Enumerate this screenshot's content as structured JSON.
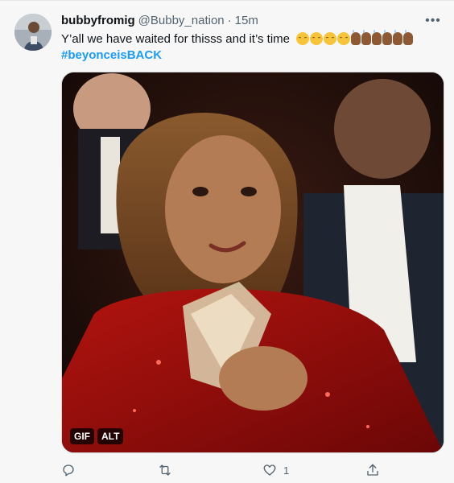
{
  "user": {
    "name": "bubbyfromig",
    "handle": "@Bubby_nation",
    "separator": "·",
    "time": "15m"
  },
  "tweet": {
    "text": "Y’all we have waited for thisss and it’s time",
    "hashtag": "#beyonceisBACK",
    "emoji": [
      "relieved-face",
      "relieved-face",
      "relieved-face",
      "relieved-face",
      "raising-hands-medium-dark",
      "raising-hands-medium-dark",
      "raising-hands-medium-dark",
      "raising-hands-medium-dark",
      "raising-hands-medium-dark",
      "raising-hands-medium-dark"
    ]
  },
  "media": {
    "gif_label": "GIF",
    "alt_label": "ALT"
  },
  "actions": {
    "reply_icon": "reply-icon",
    "retweet_icon": "retweet-icon",
    "like_icon": "like-icon",
    "like_count": "1",
    "share_icon": "share-icon",
    "more_icon": "more-icon"
  },
  "colors": {
    "link": "#1d9bf0",
    "secondary_text": "#536471",
    "primary_text": "#0f1419",
    "background": "#f7f7f7"
  }
}
